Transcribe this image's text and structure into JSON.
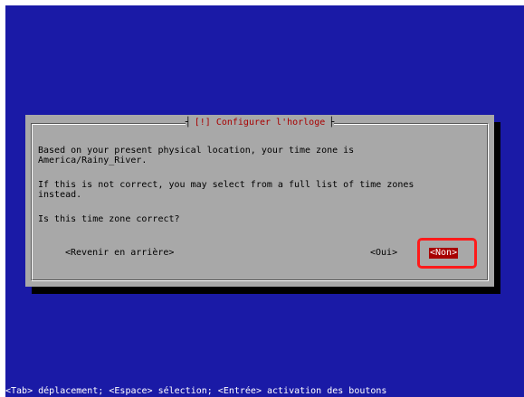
{
  "dialog": {
    "title": "[!] Configurer l'horloge",
    "line1": "Based on your present physical location, your time zone is",
    "line2": "America/Rainy_River.",
    "line3": "If this is not correct, you may select from a full list of time zones",
    "line4": "instead.",
    "question": "Is this time zone correct?",
    "buttons": {
      "back": "<Revenir en arrière>",
      "yes": "<Oui>",
      "no": "<Non>"
    },
    "selected_button": "no"
  },
  "status_bar": "<Tab> déplacement; <Espace> sélection; <Entrée> activation des boutons",
  "colors": {
    "background": "#1a1aa6",
    "dialog": "#a8a8a8",
    "title": "#a80000",
    "selected_button_bg": "#a80000",
    "highlight_outline": "#ff1a1a"
  }
}
